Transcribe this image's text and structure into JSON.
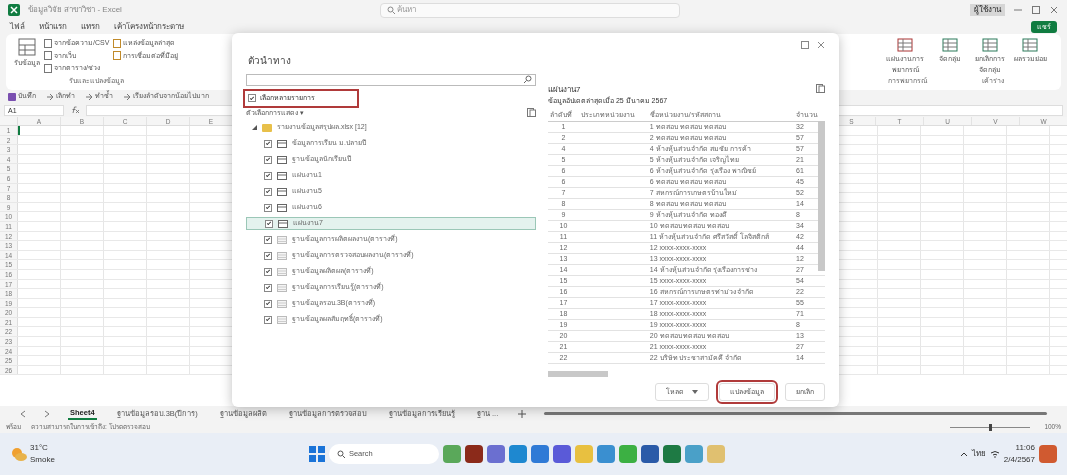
{
  "window": {
    "title": "ข้อมูลวิจัย สาขาวิชา - Excel",
    "search_placeholder": "ค้นหา",
    "account": "ผู้ใช้งาน"
  },
  "ribbon_tabs": [
    {
      "label": "ไฟล์",
      "selected": false
    },
    {
      "label": "หน้าแรก",
      "selected": false
    },
    {
      "label": "แทรก",
      "selected": false
    },
    {
      "label": "เค้าโครงหน้ากระดาษ",
      "selected": false
    }
  ],
  "share_button": "แชร์",
  "ribbon": {
    "get_data": "รับข้อมูล",
    "left_items": [
      "จากข้อความ/CSV",
      "จากเว็บ",
      "จากตาราง/ช่วง"
    ],
    "mid_items": [
      "แหล่งข้อมูลล่าสุด",
      "การเชื่อมต่อที่มีอยู่"
    ],
    "group_label": "รับและแปลงข้อมูล",
    "right_items": [
      "แผ่นงานการพยากรณ์",
      "จัดกลุ่ม",
      "ยกเลิกการจัดกลุ่ม",
      "ผลรวมย่อย"
    ],
    "right_labels": [
      "การพยากรณ์",
      "เค้าร่าง"
    ]
  },
  "quick_access": [
    "บันทึก",
    "เลิกทำ",
    "ทำซ้ำ",
    "เรียงลำดับจากน้อยไปมาก"
  ],
  "formula_bar": {
    "cell": "A1"
  },
  "columns_left": [
    "A",
    "B",
    "C",
    "D",
    "E"
  ],
  "columns_right": [
    "S",
    "T",
    "U",
    "V",
    "W"
  ],
  "rows": [
    "1",
    "2",
    "3",
    "4",
    "5",
    "6",
    "7",
    "8",
    "9",
    "10",
    "11",
    "12",
    "13",
    "14",
    "15",
    "16",
    "17",
    "18",
    "19",
    "20",
    "21",
    "22",
    "23",
    "24",
    "25",
    "26"
  ],
  "sheet_tabs": [
    {
      "label": "Sheet4",
      "selected": true
    },
    {
      "label": "ฐานข้อมูลรอบ.3B(ปีการ)",
      "selected": false
    },
    {
      "label": "ฐานข้อมูลผลิต",
      "selected": false
    },
    {
      "label": "ฐานข้อมูลการตรวจสอบ",
      "selected": false
    },
    {
      "label": "ฐานข้อมูลการเรียนรู้",
      "selected": false
    },
    {
      "label": "ฐาน ...",
      "selected": false
    }
  ],
  "status_bar": {
    "mode": "พร้อม",
    "accessibility": "ความสามารถในการเข้าถึง: โปรดตรวจสอบ",
    "zoom_slider": {
      "level": 0.5
    },
    "zoom": "100%"
  },
  "navigator": {
    "title": "ตัวนำทาง",
    "multi_select": {
      "label": "เลือกหลายรายการ",
      "checked": true,
      "highlighted": true
    },
    "display_options": "ตัวเลือกการแสดง ▾",
    "file": "รายงานข้อมูลสรุปผล.xlsx [12]",
    "items": [
      {
        "label": "ข้อมูลการเรียน ม.ปลายปี",
        "kind": "sheet",
        "checked": true,
        "selected": false
      },
      {
        "label": "ฐานข้อมูลนักเรียนปี",
        "kind": "sheet",
        "checked": true,
        "selected": false
      },
      {
        "label": "แผ่นงาน1",
        "kind": "sheet",
        "checked": true,
        "selected": false
      },
      {
        "label": "แผ่นงาน5",
        "kind": "sheet",
        "checked": true,
        "selected": false
      },
      {
        "label": "แผ่นงาน6",
        "kind": "sheet",
        "checked": true,
        "selected": false
      },
      {
        "label": "แผ่นงาน7",
        "kind": "sheet",
        "checked": true,
        "selected": true
      },
      {
        "label": "ฐานข้อมูลการผลิตผลงาน(ตารางที่)",
        "kind": "table",
        "checked": true,
        "selected": false
      },
      {
        "label": "ฐานข้อมูลการตรวจสอบผลงาน(ตารางที่)",
        "kind": "table",
        "checked": true,
        "selected": false
      },
      {
        "label": "ฐานข้อมูลผลิตผล(ตารางที่)",
        "kind": "table",
        "checked": true,
        "selected": false
      },
      {
        "label": "ฐานข้อมูลการเรียนรู้(ตารางที่)",
        "kind": "table",
        "checked": true,
        "selected": false
      },
      {
        "label": "ฐานข้อมูลรอบ.3B(ตารางที่)",
        "kind": "table",
        "checked": true,
        "selected": false
      },
      {
        "label": "ฐานข้อมูลผลสัมฤทธิ์(ตารางที่)",
        "kind": "table",
        "checked": true,
        "selected": false
      }
    ],
    "preview": {
      "title": "แผ่นงาน7",
      "subtitle": "ข้อมูลอัปเดตล่าสุดเมื่อ 25 มีนาคม 2567",
      "columns": [
        "ลำดับที่",
        "ประเภทหน่วยงาน",
        "ชื่อหน่วยงาน/รหัสสถาน",
        "จำนวน"
      ],
      "rows": [
        [
          "1",
          "",
          "1 ทดสอบ ทดสอบ ทดสอบ",
          "32"
        ],
        [
          "2",
          "",
          "2 ทดสอบ ทดสอบ ทดสอบ",
          "57"
        ],
        [
          "4",
          "",
          "4 ห้างหุ้นส่วนจำกัด สมชัย การค้า",
          "57"
        ],
        [
          "5",
          "",
          "5 ห้างหุ้นส่วนจำกัด เจริญไทย",
          "21"
        ],
        [
          "6",
          "",
          "6 ห้างหุ้นส่วนจำกัด รุ่งเรือง พาณิชย์",
          "61"
        ],
        [
          "6",
          "",
          "6 ทดสอบ ทดสอบ ทดสอบ",
          "45"
        ],
        [
          "7",
          "",
          "7 สหกรณ์การเกษตรบ้านใหม่",
          "52"
        ],
        [
          "8",
          "",
          "8 ทดสอบ ทดสอบ ทดสอบ",
          "14"
        ],
        [
          "9",
          "",
          "9 ห้างหุ้นส่วนจำกัด ทองดี",
          "8"
        ],
        [
          "10",
          "",
          "10 ทดสอบ ทดสอบ ทดสอบ",
          "34"
        ],
        [
          "11",
          "",
          "11 ห้างหุ้นส่วนจำกัด ศรีสวัสดิ์ โลจิสติกส์",
          "42"
        ],
        [
          "12",
          "",
          "12 xxxx-xxxx-xxxx",
          "44"
        ],
        [
          "13",
          "",
          "13 xxxx-xxxx-xxxx",
          "12"
        ],
        [
          "14",
          "",
          "14 ห้างหุ้นส่วนจำกัด รุ่งเรืองการช่าง",
          "27"
        ],
        [
          "15",
          "",
          "15 xxxx-xxxx-xxxx",
          "54"
        ],
        [
          "16",
          "",
          "16 สหกรณ์การเกษตรท่าม่วง จำกัด",
          "22"
        ],
        [
          "17",
          "",
          "17 xxxx-xxxx-xxxx",
          "55"
        ],
        [
          "18",
          "",
          "18 xxxx-xxxx-xxxx",
          "71"
        ],
        [
          "19",
          "",
          "19 xxxx-xxxx-xxxx",
          "8"
        ],
        [
          "20",
          "",
          "20 ทดสอบ ทดสอบ ทดสอบ",
          "13"
        ],
        [
          "21",
          "",
          "21 xxxx-xxxx-xxxx",
          "27"
        ],
        [
          "22",
          "",
          "22 บริษัท ประชาสามัคคี จำกัด",
          "14"
        ]
      ]
    },
    "buttons": [
      {
        "label": "โหลด",
        "kind": "split",
        "highlighted": false
      },
      {
        "label": "แปลงข้อมูล",
        "kind": "plain",
        "highlighted": true
      },
      {
        "label": "ยกเลิก",
        "kind": "plain",
        "highlighted": false
      }
    ]
  },
  "taskbar": {
    "weather_temp": "31°C",
    "weather_text": "Smoke",
    "search": "Search",
    "language": "ไทย",
    "time": "11:06",
    "date": "2/4/2567"
  }
}
